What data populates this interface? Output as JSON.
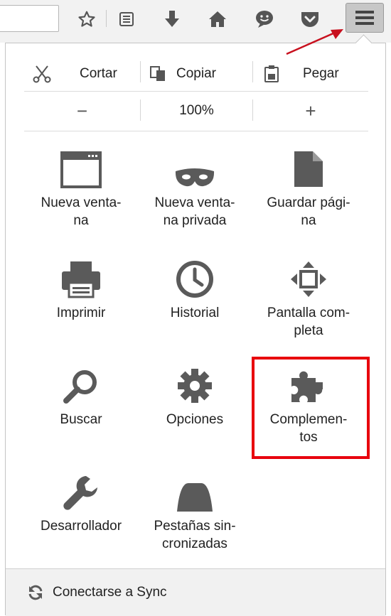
{
  "toolbar": {
    "icons": [
      "star-icon",
      "reading-list-icon",
      "download-icon",
      "home-icon",
      "chat-icon",
      "pocket-icon"
    ],
    "menu_button": "hamburger-menu-icon"
  },
  "edit": {
    "cut": "Cortar",
    "copy": "Copiar",
    "paste": "Pegar"
  },
  "zoom": {
    "out": "−",
    "level": "100%",
    "in": "+"
  },
  "items": {
    "new_window": "Nueva venta-\nna",
    "private_window": "Nueva venta-\nna privada",
    "save_page": "Guardar pági-\nna",
    "print": "Imprimir",
    "history": "Historial",
    "fullscreen": "Pantalla com-\npleta",
    "find": "Buscar",
    "options": "Opciones",
    "addons": "Complemen-\ntos",
    "developer": "Desarrollador",
    "synced_tabs": "Pestañas sin-\ncronizadas"
  },
  "footer": {
    "sync": "Conectarse a Sync"
  },
  "colors": {
    "icon": "#5a5a5a",
    "highlight": "#e8000d",
    "arrow": "#c8101e"
  }
}
